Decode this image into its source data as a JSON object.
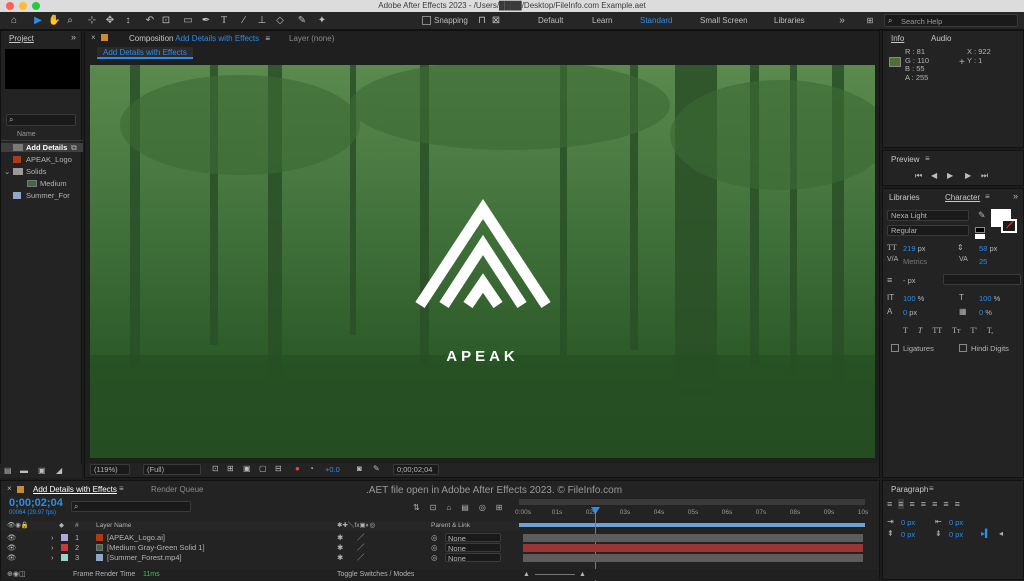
{
  "window": {
    "title": "Adobe After Effects 2023 - /Users/████/Desktop/FileInfo.com Example.aet"
  },
  "toolbar": {
    "snapping_label": "Snapping",
    "workspaces": [
      "Default",
      "Learn",
      "Standard",
      "Small Screen",
      "Libraries"
    ],
    "active_workspace": "Standard",
    "search_placeholder": "Search Help"
  },
  "project": {
    "tab": "Project",
    "column_name": "Name",
    "items": [
      {
        "name": "Add Details",
        "type": "composition",
        "selected": true
      },
      {
        "name": "APEAK_Logo",
        "type": "illustrator"
      },
      {
        "name": "Solids",
        "type": "folder"
      },
      {
        "name": "Medium",
        "type": "solid"
      },
      {
        "name": "Summer_For",
        "type": "footage"
      }
    ]
  },
  "composition": {
    "tab_prefix": "Composition",
    "tab_name": "Add Details with Effects",
    "layer_tab": "Layer (none)",
    "breadcrumb": "Add Details with Effects",
    "logo_text": "APEAK",
    "zoom": "(119%)",
    "resolution": "(Full)",
    "exposure": "+0.0",
    "timecode": "0;00;02;04"
  },
  "info": {
    "tab": "Info",
    "audio_tab": "Audio",
    "color": "#516e37",
    "r": "R : 81",
    "g": "G : 110",
    "b": "B : 55",
    "a": "A : 255",
    "x": "X : 922",
    "y": "Y : 1"
  },
  "preview": {
    "tab": "Preview"
  },
  "character": {
    "libraries_tab": "Libraries",
    "tab": "Character",
    "font": "Nexa Light",
    "style": "Regular",
    "font_size": "219",
    "leading": "58",
    "kerning": "Metrics",
    "tracking": "25",
    "stroke_width": "- px",
    "vscale": "100",
    "hscale": "100",
    "baseline": "0",
    "tsume": "0",
    "unit_px": "px",
    "unit_pct": "%",
    "ligatures": "Ligatures",
    "hindi_digits": "Hindi Digits",
    "style_buttons": [
      "T",
      "T",
      "TT",
      "Tт",
      "T'",
      "T,"
    ]
  },
  "paragraph": {
    "tab": "Paragraph",
    "indent_left": "0 px",
    "indent_first": "0 px",
    "indent_right": "0 px",
    "space_before": "0 px",
    "space_after": "0 px"
  },
  "timeline": {
    "tab": "Add Details with Effects",
    "render_queue_tab": "Render Queue",
    "timecode": "0;00;02;04",
    "fps": "00064 (29.97 fps)",
    "watermark": ".AET file open in Adobe After Effects 2023. © FileInfo.com",
    "col_layer_name": "Layer Name",
    "col_parent": "Parent & Link",
    "col_num": "#",
    "layers": [
      {
        "num": "1",
        "name": "[APEAK_Logo.ai]",
        "color": "#b0a8d8",
        "parent": "None"
      },
      {
        "num": "2",
        "name": "[Medium Gray-Green Solid 1]",
        "color": "#c73b3b",
        "parent": "None"
      },
      {
        "num": "3",
        "name": "[Summer_Forest.mp4]",
        "color": "#9ed2c8",
        "parent": "None"
      }
    ],
    "ruler": [
      "0:00s",
      "01s",
      "02s",
      "03s",
      "04s",
      "05s",
      "06s",
      "07s",
      "08s",
      "09s",
      "10s"
    ],
    "frame_render_label": "Frame Render Time",
    "frame_render_value": "11ms",
    "toggle_label": "Toggle Switches / Modes"
  },
  "colors": {
    "accent": "#2d8ceb",
    "panel": "#232323",
    "bar_layer1": "#5d5d5d",
    "bar_layer2": "#9b3535",
    "bar_layer3": "#5d5d5d"
  }
}
